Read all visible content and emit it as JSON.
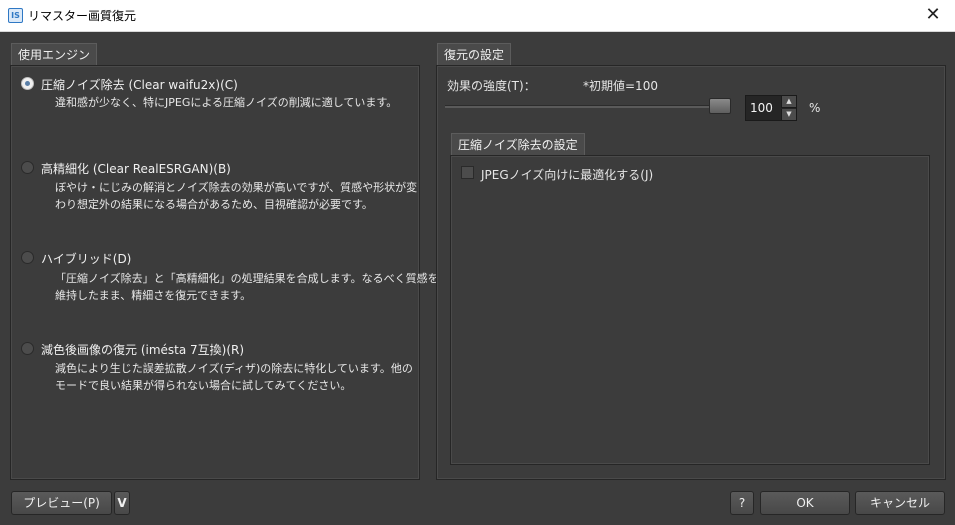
{
  "window": {
    "title": "リマスター画質復元",
    "app_icon": "IS",
    "close_glyph": "✕"
  },
  "engine": {
    "tab_label": "使用エンジン",
    "options": [
      {
        "label": "圧縮ノイズ除去 (Clear waifu2x)(C)",
        "selected": true,
        "desc": [
          "違和感が少なく、特にJPEGによる圧縮ノイズの削減に適しています。"
        ]
      },
      {
        "label": "高精細化 (Clear RealESRGAN)(B)",
        "selected": false,
        "desc": [
          "ぼやけ・にじみの解消とノイズ除去の効果が高いですが、質感や形状が変",
          "わり想定外の結果になる場合があるため、目視確認が必要です。"
        ]
      },
      {
        "label": "ハイブリッド(D)",
        "selected": false,
        "desc": [
          "「圧縮ノイズ除去」と「高精細化」の処理結果を合成します。なるべく質感を",
          "維持したまま、精細さを復元できます。"
        ]
      },
      {
        "label": "減色後画像の復元 (iméstа 7互換)(R)",
        "selected": false,
        "desc": [
          "減色により生じた誤差拡散ノイズ(ディザ)の除去に特化しています。他の",
          "モードで良い結果が得られない場合に試してみてください。"
        ]
      }
    ]
  },
  "settings": {
    "tab_label": "復元の設定",
    "strength_label": "効果の強度(T)：",
    "default_note": "*初期値=100",
    "strength_value": "100",
    "strength_fraction": 1.0,
    "unit": "%",
    "noise": {
      "tab_label": "圧縮ノイズ除去の設定",
      "jpeg_checkbox_label": "JPEGノイズ向けに最適化する(J)",
      "jpeg_checked": false
    }
  },
  "footer": {
    "preview_label": "プレビュー(P)",
    "preview_menu_glyph": "V",
    "help_label": "?",
    "ok_label": "OK",
    "cancel_label": "キャンセル"
  }
}
